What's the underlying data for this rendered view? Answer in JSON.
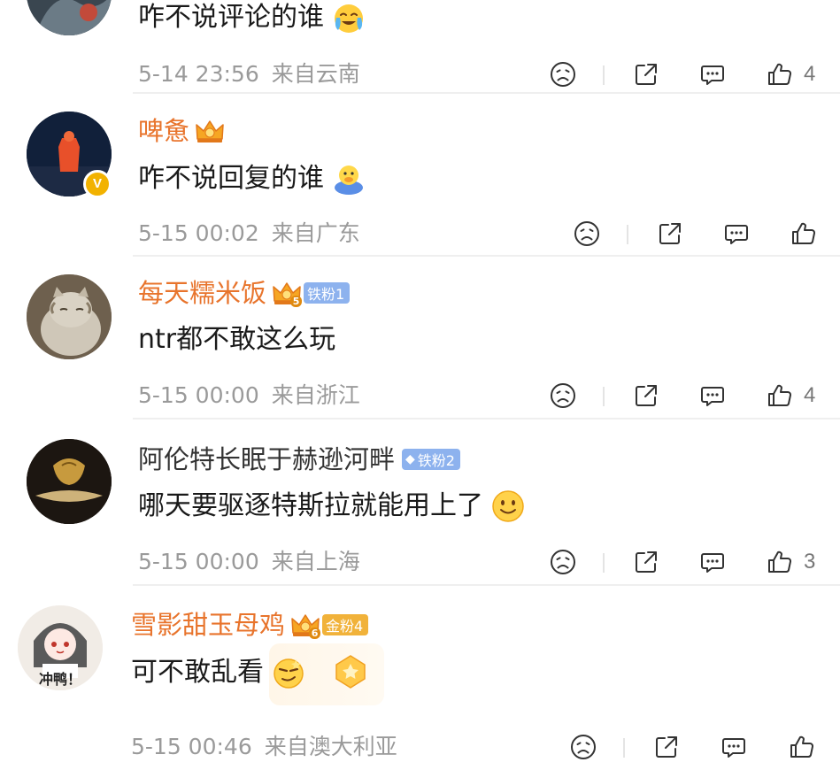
{
  "comments": [
    {
      "id": "c0",
      "username": "",
      "text": "咋不说评论的谁",
      "emoji": "crying-laugh-emoji",
      "date": "5-14 23:56",
      "location": "来自云南",
      "likes": "4"
    },
    {
      "id": "c1",
      "username": "啤惫",
      "crown_level": "",
      "verified": "V",
      "text": "咋不说回复的谁",
      "emoji": "duck-emoji",
      "date": "5-15 00:02",
      "location": "来自广东",
      "likes": ""
    },
    {
      "id": "c2",
      "username": "每天糯米饭",
      "crown_level": "5",
      "fan_badge": "铁粉1",
      "text": "ntr都不敢这么玩",
      "date": "5-15 00:00",
      "location": "来自浙江",
      "likes": "4"
    },
    {
      "id": "c3",
      "username": "阿伦特长眠于赫逊河畔",
      "fan_badge": "铁粉2",
      "text": "哪天要驱逐特斯拉就能用上了",
      "emoji": "smile-emoji",
      "date": "5-15 00:00",
      "location": "来自上海",
      "likes": "3"
    },
    {
      "id": "c4",
      "username": "雪影甜玉母鸡",
      "crown_level": "6",
      "fan_badge": "金粉4",
      "avatar_text": "冲鸭！",
      "text": "可不敢乱看",
      "emoji": "sly-emoji",
      "date": "5-15 00:46",
      "location": "来自澳大利亚",
      "likes": ""
    }
  ],
  "icons": {
    "dislike": "frown-face-icon",
    "share": "share-icon",
    "reply": "comment-bubble-icon",
    "like": "thumbs-up-icon"
  },
  "colors": {
    "username_vip": "#e8742c",
    "username_normal": "#333333",
    "meta_gray": "#9a9a9a",
    "iron_fan_badge": "#8db2ee",
    "gold_fan_badge": "#f1b23a"
  }
}
